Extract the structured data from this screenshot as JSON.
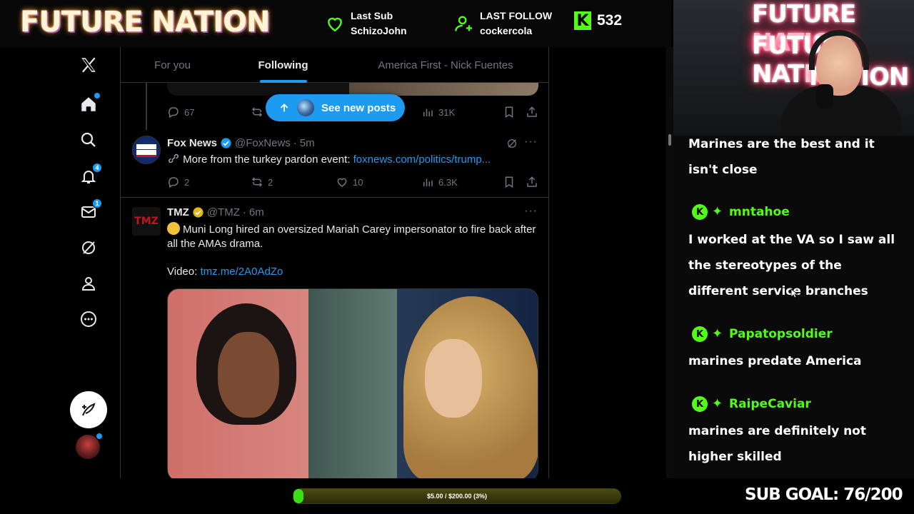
{
  "stream": {
    "brand": "FUTURE NATION",
    "webcam_sign_lines": [
      "FUTURE NATION",
      "FUTURE NATION",
      "NATION"
    ],
    "last_sub": {
      "label": "Last Sub",
      "name": "SchizoJohn"
    },
    "last_follow": {
      "label": "LAST FOLLOW",
      "name": "cockercola"
    },
    "kick_icon": "kick-logo-icon",
    "kick_count": "532",
    "goal_progress_text": "$5.00 / $200.00 (3%)",
    "goal_fraction": 0.03,
    "sub_goal": "SUB GOAL: 76/200",
    "colors": {
      "kick_green": "#53fc18",
      "x_blue": "#1d9bf0"
    }
  },
  "nav": {
    "items": [
      {
        "icon": "x-logo-icon"
      },
      {
        "icon": "home-icon"
      },
      {
        "icon": "search-icon"
      },
      {
        "icon": "notifications-icon",
        "badge": "4"
      },
      {
        "icon": "messages-icon",
        "badge": "1"
      },
      {
        "icon": "grok-icon"
      },
      {
        "icon": "profile-icon"
      },
      {
        "icon": "more-icon"
      }
    ],
    "post_button_icon": "compose-icon"
  },
  "tabs": [
    "For you",
    "Following",
    "America First - Nick Fuentes"
  ],
  "new_posts_label": "See new posts",
  "previous_post": {
    "replies": "67",
    "views": "31K"
  },
  "posts": [
    {
      "name": "Fox News",
      "verified": true,
      "handle": "@FoxNews",
      "time": "5m",
      "text": "More from the turkey pardon event: ",
      "link": "foxnews.com/politics/trump...",
      "replies": "2",
      "reposts": "2",
      "likes": "10",
      "views": "6.3K"
    },
    {
      "name": "TMZ",
      "verified": true,
      "handle": "@TMZ",
      "time": "6m",
      "text": "Muni Long hired an oversized Mariah Carey impersonator to fire back after all the AMAs drama.",
      "video_label": "Video: ",
      "link": "tmz.me/2A0AdZo"
    }
  ],
  "chat": [
    {
      "user": "",
      "message": "Marines are the best and it isn't close"
    },
    {
      "user": "mntahoe",
      "message": "I worked at the VA so I saw all the stereotypes of the different service branches"
    },
    {
      "user": "Papatopsoldier",
      "message": "marines predate America"
    },
    {
      "user": "RaipeCaviar",
      "message": "marines are definitely not higher skilled"
    }
  ]
}
